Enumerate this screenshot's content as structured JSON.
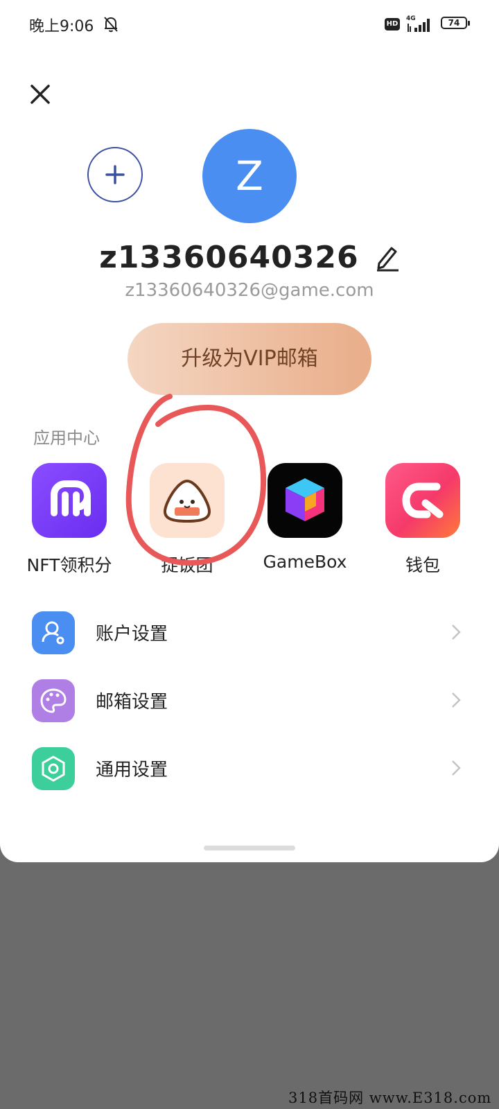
{
  "status_bar": {
    "time": "晚上9:06",
    "hd": "HD",
    "network": "4G",
    "battery": "74"
  },
  "account": {
    "avatar_letter": "Z",
    "username": "z13360640326",
    "email": "z13360640326@game.com",
    "vip_label": "升级为VIP邮箱"
  },
  "app_center": {
    "title": "应用中心",
    "apps": [
      {
        "label": "NFT领积分",
        "icon": "nft-m-icon"
      },
      {
        "label": "捉饭团",
        "icon": "rice-ball-icon"
      },
      {
        "label": "GameBox",
        "icon": "cube-icon"
      },
      {
        "label": "钱包",
        "icon": "wallet-g-icon"
      }
    ]
  },
  "settings": [
    {
      "label": "账户设置",
      "icon": "user-gear-icon",
      "color": "#4a8ef2"
    },
    {
      "label": "邮箱设置",
      "icon": "palette-icon",
      "color": "#b07fe6"
    },
    {
      "label": "通用设置",
      "icon": "hexagon-icon",
      "color": "#3ccf9b"
    }
  ],
  "watermark": "318首码网 www.E318.com",
  "colors": {
    "avatar": "#4a8ef2",
    "annotation": "#e85858",
    "backdrop": "#6b6b6b"
  }
}
